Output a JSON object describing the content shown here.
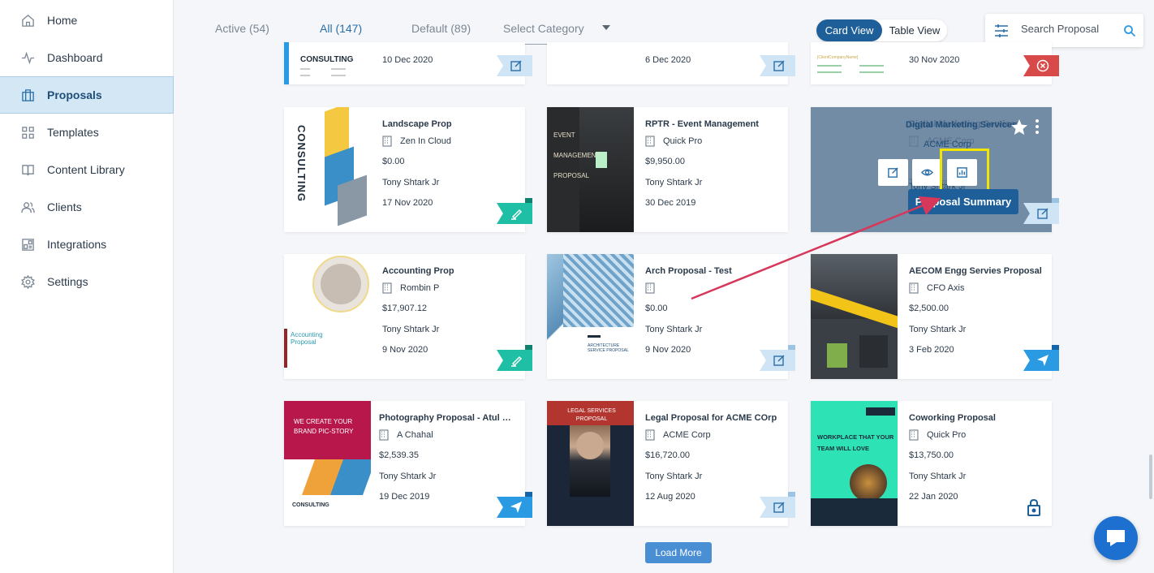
{
  "sidebar": {
    "items": [
      {
        "label": "Home",
        "icon": "home-icon"
      },
      {
        "label": "Dashboard",
        "icon": "activity-icon"
      },
      {
        "label": "Proposals",
        "icon": "briefcase-icon",
        "active": true
      },
      {
        "label": "Templates",
        "icon": "grid-icon"
      },
      {
        "label": "Content Library",
        "icon": "book-icon"
      },
      {
        "label": "Clients",
        "icon": "users-icon"
      },
      {
        "label": "Integrations",
        "icon": "integrations-icon"
      },
      {
        "label": "Settings",
        "icon": "gear-icon"
      }
    ]
  },
  "tabs": {
    "active": "Active (54)",
    "all": "All (147)",
    "default": "Default (89)",
    "category": "Select Category"
  },
  "view": {
    "card": "Card View",
    "table": "Table View"
  },
  "search": {
    "placeholder": "Search Proposal"
  },
  "top_row": [
    {
      "date": "10 Dec 2020",
      "thumb_text": "CONSULTING",
      "status": "edit"
    },
    {
      "date": "6 Dec 2020",
      "status": "edit"
    },
    {
      "date": "30 Nov 2020",
      "thumb_text": "[ClientCompanyName]",
      "status": "rejected"
    }
  ],
  "cards": [
    {
      "title": "Landscape Prop",
      "client": "Zen In Cloud",
      "amount": "$0.00",
      "owner": "Tony Shtark Jr",
      "date": "17 Nov 2020",
      "status": "sign",
      "thumb": "CONSULTING"
    },
    {
      "title": "RPTR - Event Management",
      "client": "Quick Pro",
      "amount": "$9,950.00",
      "owner": "Tony Shtark Jr",
      "date": "30 Dec 2019",
      "status": "none",
      "thumb": "EVENT MANAGEMENT PROPOSAL"
    },
    {
      "title": "Digital Marketing Services",
      "client": "ACME Corp",
      "amount": "",
      "owner": "Tony Shtark Jr",
      "date": "",
      "status": "edit",
      "thumb": ""
    },
    {
      "title": "Accounting Prop",
      "client": "Rombin P",
      "amount": "$17,907.12",
      "owner": "Tony Shtark Jr",
      "date": "9 Nov 2020",
      "status": "sign",
      "thumb": "Accounting Proposal"
    },
    {
      "title": "Arch Proposal - Test",
      "client": "",
      "amount": "$0.00",
      "owner": "Tony Shtark Jr",
      "date": "9 Nov 2020",
      "status": "edit",
      "thumb": "ARCHITECTURE SERVICE PROPOSAL"
    },
    {
      "title": "AECOM Engg Servies Proposal",
      "client": "CFO Axis",
      "amount": "$2,500.00",
      "owner": "Tony Shtark Jr",
      "date": "3 Feb 2020",
      "status": "send",
      "thumb": ""
    },
    {
      "title": "Photography Proposal - Atul Cha...",
      "client": "A Chahal",
      "amount": "$2,539.35",
      "owner": "Tony Shtark Jr",
      "date": "19 Dec 2019",
      "status": "send",
      "thumb": "WE CREATE YOUR BRAND PIC-STORY"
    },
    {
      "title": "Legal Proposal for ACME COrp",
      "client": "ACME Corp",
      "amount": "$16,720.00",
      "owner": "Tony Shtark Jr",
      "date": "12 Aug 2020",
      "status": "edit",
      "thumb": "LEGAL SERVICES PROPOSAL"
    },
    {
      "title": "Coworking Proposal",
      "client": "Quick Pro",
      "amount": "$13,750.00",
      "owner": "Tony Shtark Jr",
      "date": "22 Jan 2020",
      "status": "locked",
      "thumb": "WORKPLACE THAT YOUR TEAM WILL LOVE"
    }
  ],
  "hover": {
    "tooltip": "Proposal Summary"
  },
  "load_more": "Load More",
  "colors": {
    "primary": "#1f5f99",
    "accent": "#2a6fa8",
    "sign": "#1fbfa6",
    "send": "#2a9ae3",
    "reject": "#d84a4a",
    "highlight": "#f2e600",
    "arrow": "#d6375a"
  }
}
